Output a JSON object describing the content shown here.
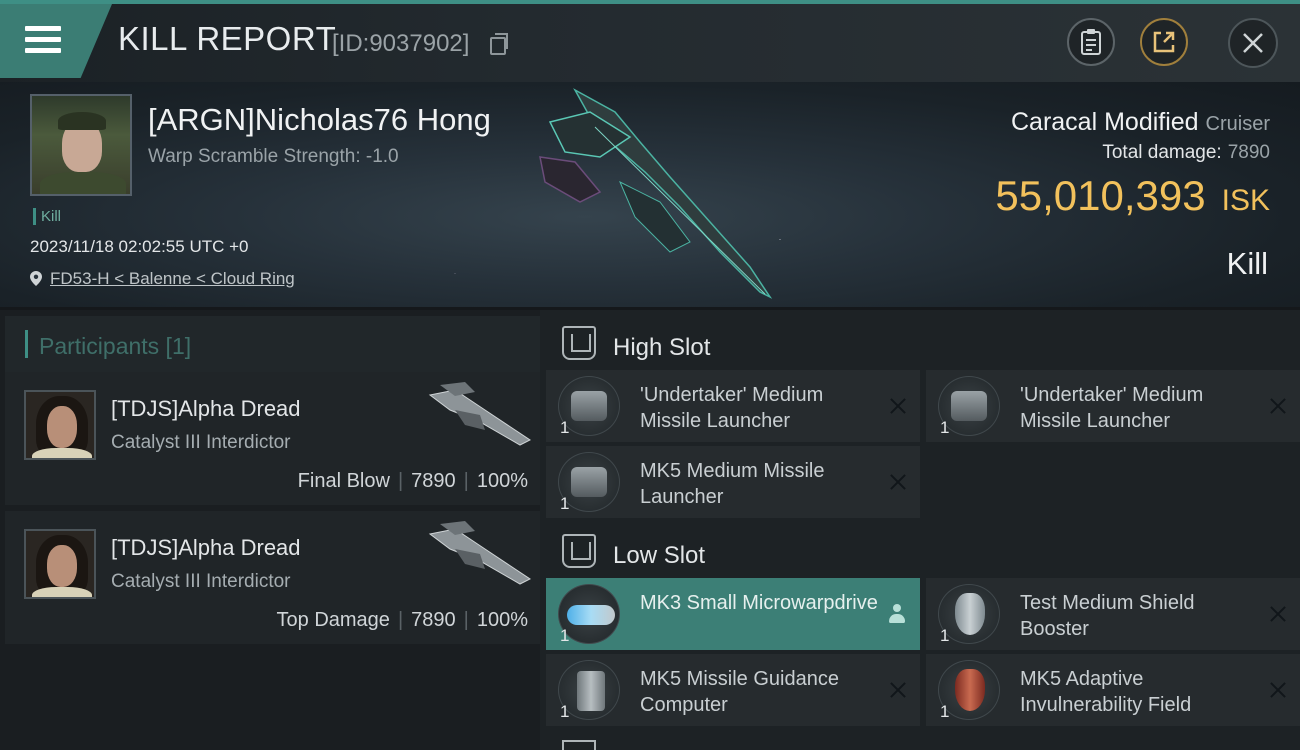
{
  "header": {
    "title": "KILL REPORT",
    "report_id": "[ID:9037902]"
  },
  "victim": {
    "name": "[ARGN]Nicholas76 Hong",
    "scram": "Warp Scramble Strength: -1.0",
    "kill_tag": "Kill",
    "timestamp": "2023/11/18 02:02:55 UTC +0",
    "location": "FD53-H < Balenne < Cloud Ring",
    "ship_name": "Caracal Modified",
    "ship_class": "Cruiser",
    "total_damage_label": "Total damage:",
    "total_damage": "7890",
    "isk_value": "55,010,393",
    "isk_unit": "ISK",
    "result": "Kill"
  },
  "participants": {
    "header": "Participants [1]",
    "items": [
      {
        "name": "[TDJS]Alpha Dread",
        "ship": "Catalyst III Interdictor",
        "role": "Final Blow",
        "damage": "7890",
        "percent": "100%"
      },
      {
        "name": "[TDJS]Alpha Dread",
        "ship": "Catalyst III Interdictor",
        "role": "Top Damage",
        "damage": "7890",
        "percent": "100%"
      }
    ]
  },
  "fitting": {
    "high_slot": {
      "title": "High Slot",
      "modules": [
        {
          "name": "'Undertaker' Medium Missile Launcher",
          "qty": "1"
        },
        {
          "name": "'Undertaker' Medium Missile Launcher",
          "qty": "1"
        },
        {
          "name": "MK5 Medium Missile Launcher",
          "qty": "1"
        }
      ]
    },
    "low_slot": {
      "title": "Low Slot",
      "modules": [
        {
          "name": "MK3 Small Microwarpdrive",
          "qty": "1"
        },
        {
          "name": "Test Medium Shield Booster",
          "qty": "1"
        },
        {
          "name": "MK5 Missile Guidance Computer",
          "qty": "1"
        },
        {
          "name": "MK5 Adaptive Invulnerability Field",
          "qty": "1"
        }
      ]
    }
  },
  "colors": {
    "accent": "#3e8f85",
    "isk_gold": "#f2c15c",
    "panel_dark": "#1a1e21"
  }
}
